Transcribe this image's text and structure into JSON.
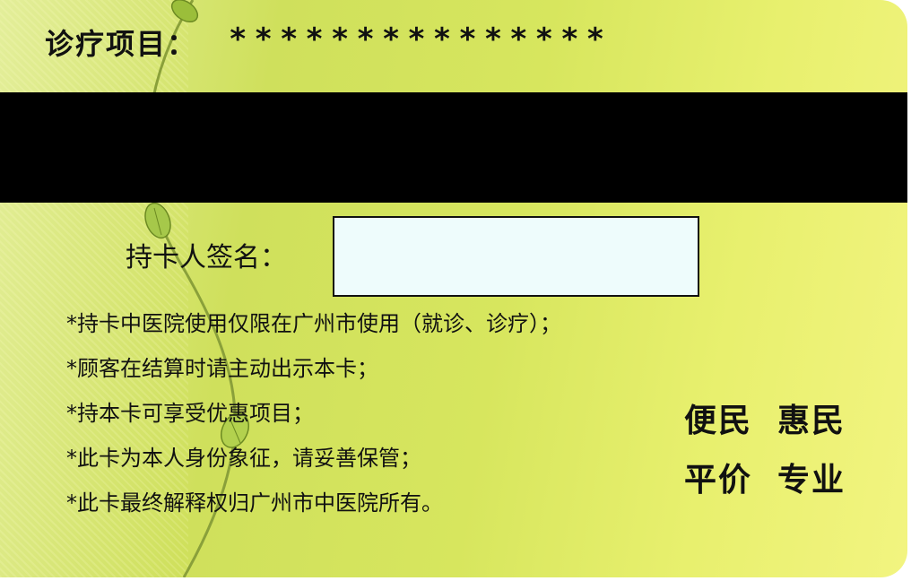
{
  "card": {
    "project_label": "诊疗项目：",
    "project_value": "***************",
    "signature_label": "持卡人签名：",
    "rules": [
      "*持卡中医院使用仅限在广州市使用（就诊、诊疗）；",
      "*顾客在结算时请主动出示本卡；",
      "*持本卡可享受优惠项目；",
      "*此卡为本人身份象征，请妥善保管；",
      "*此卡最终解释权归广州市中医院所有。"
    ],
    "slogans": {
      "row1_left": "便民",
      "row1_right": "惠民",
      "row2_left": "平价",
      "row2_right": "专业"
    }
  },
  "colors": {
    "card_green": "#d4e45e",
    "stripe": "#000000",
    "signature_box": "#eefcfc"
  },
  "decorations": [
    "vine-icon",
    "leaf-icon"
  ]
}
